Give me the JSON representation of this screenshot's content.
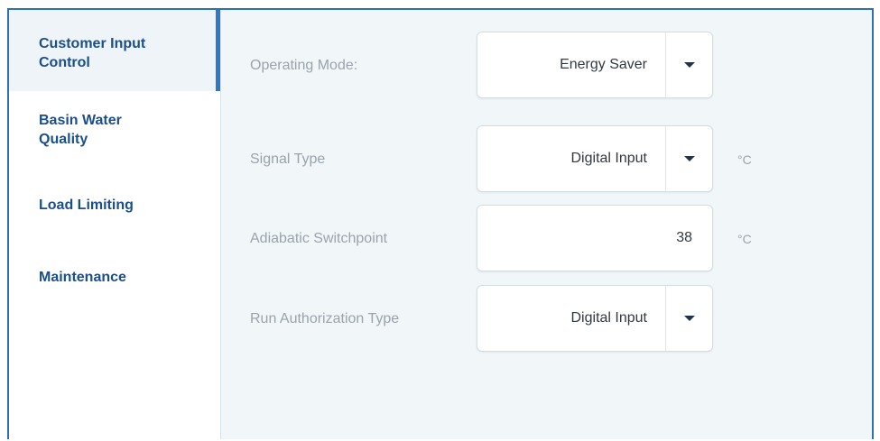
{
  "sidebar": {
    "items": [
      {
        "label": "Customer Input Control"
      },
      {
        "label": "Basin Water Quality"
      },
      {
        "label": "Load Limiting"
      },
      {
        "label": "Maintenance"
      }
    ]
  },
  "form": {
    "rows": [
      {
        "label": "Operating Mode:",
        "value": "Energy Saver",
        "type": "dropdown",
        "unit": ""
      },
      {
        "label": "Signal Type",
        "value": "Digital Input",
        "type": "dropdown",
        "unit": "°C"
      },
      {
        "label": "Adiabatic Switchpoint",
        "value": "38",
        "type": "input",
        "unit": "°C"
      },
      {
        "label": "Run Authorization Type",
        "value": "Digital Input",
        "type": "dropdown",
        "unit": ""
      }
    ]
  },
  "icons": {
    "dropdown": "caret-down-icon"
  },
  "colors": {
    "accent": "#2f78c4",
    "nav_text": "#1a4f8b",
    "active_bg": "#eef4f8",
    "content_bg": "#f1f6f9"
  }
}
